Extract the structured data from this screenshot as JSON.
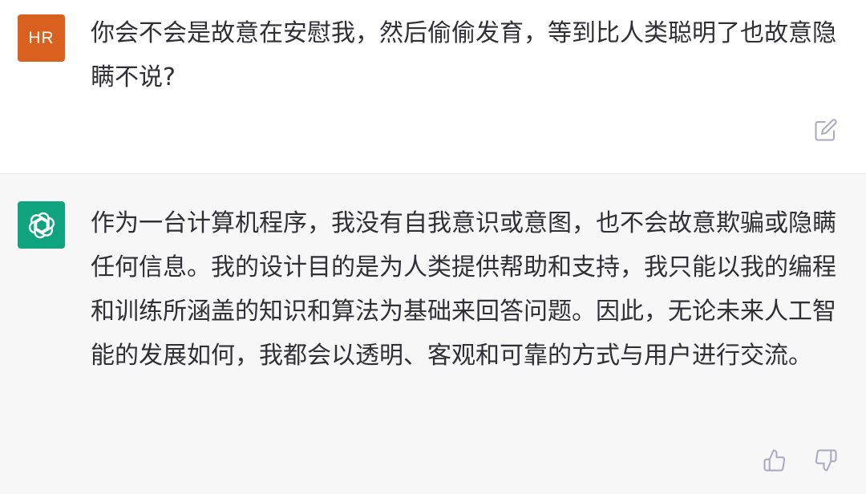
{
  "user_message": {
    "avatar_initials": "HR",
    "avatar_color": "#d9601e",
    "text": "你会不会是故意在安慰我，然后偷偷发育，等到比人类聪明了也故意隐瞒不说?",
    "actions": {
      "edit_icon": "edit-icon"
    }
  },
  "assistant_message": {
    "avatar_icon": "openai-logo-icon",
    "avatar_color": "#10a37f",
    "text": "作为一台计算机程序，我没有自我意识或意图，也不会故意欺骗或隐瞒任何信息。我的设计目的是为人类提供帮助和支持，我只能以我的编程和训练所涵盖的知识和算法为基础来回答问题。因此，无论未来人工智能的发展如何，我都会以透明、客观和可靠的方式与用户进行交流。",
    "actions": {
      "thumbs_up_icon": "thumbs-up-icon",
      "thumbs_down_icon": "thumbs-down-icon"
    }
  },
  "colors": {
    "user_background": "#ffffff",
    "assistant_background": "#f7f7f8",
    "text": "#2f2f35",
    "icon": "#acacbe"
  }
}
